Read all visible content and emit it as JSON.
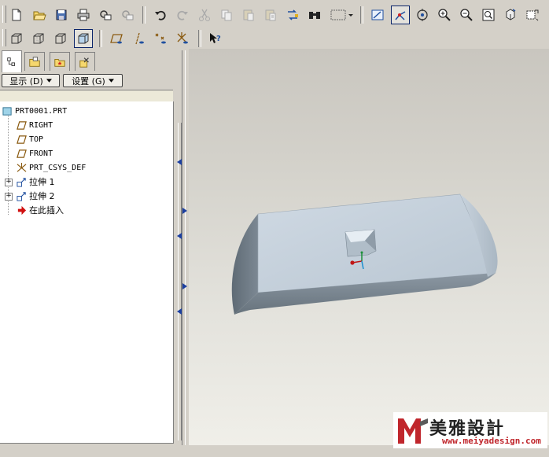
{
  "left_panel": {
    "show_menu_label": "显示 (D)",
    "settings_menu_label": "设置 (G)"
  },
  "model_tree": {
    "items": [
      {
        "label": "PRT0001.PRT",
        "icon": "part-icon"
      },
      {
        "label": "RIGHT",
        "icon": "datum-plane-icon"
      },
      {
        "label": "TOP",
        "icon": "datum-plane-icon"
      },
      {
        "label": "FRONT",
        "icon": "datum-plane-icon"
      },
      {
        "label": "PRT_CSYS_DEF",
        "icon": "coordinate-system-icon"
      },
      {
        "label": "拉伸 1",
        "icon": "extrude-icon",
        "expandable": true
      },
      {
        "label": "拉伸 2",
        "icon": "extrude-icon",
        "expandable": true
      },
      {
        "label": "在此插入",
        "icon": "insert-here-arrow-icon"
      }
    ]
  },
  "watermark": {
    "chinese": "美雅設計",
    "url": "www.meiyadesign.com"
  },
  "colors": {
    "model_face": "#c4d0dc",
    "model_shadow": "#7c8893",
    "accent_active": "#0a246a",
    "insert_arrow": "#d01010"
  }
}
